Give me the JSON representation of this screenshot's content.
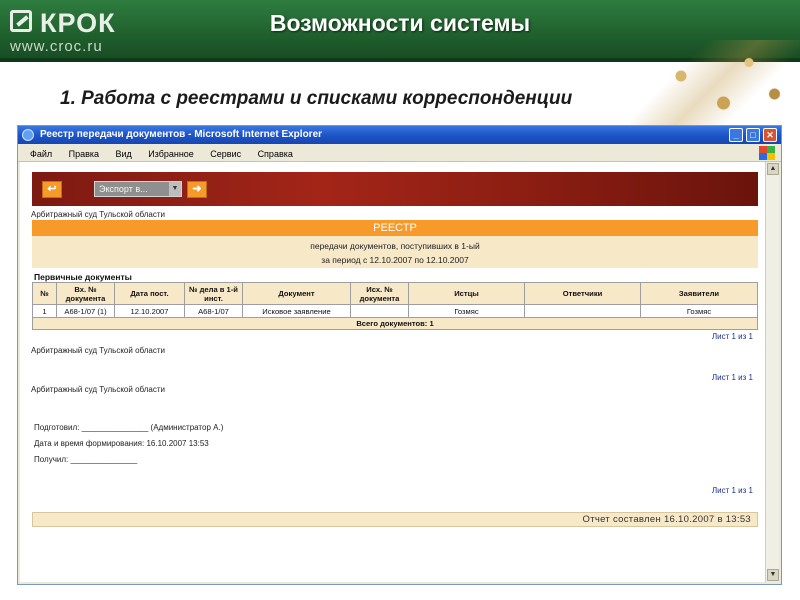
{
  "slide": {
    "logo_text": "КРОК",
    "logo_url": "www.croc.ru",
    "title": "Возможности системы",
    "subtitle": "1. Работа с реестрами и списками корреспонденции"
  },
  "browser": {
    "window_title": "Реестр передачи документов - Microsoft Internet Explorer",
    "menu": [
      "Файл",
      "Правка",
      "Вид",
      "Избранное",
      "Сервис",
      "Справка"
    ]
  },
  "page": {
    "export_select": "Экспорт в...",
    "court_name": "Арбитражный суд Тульской области",
    "registry_title": "РЕЕСТР",
    "registry_line1": "передачи документов, поступивших в 1-ый",
    "registry_line2": "за период с 12.10.2007 по 12.10.2007",
    "primary_docs_label": "Первичные документы",
    "table": {
      "headers": [
        "№",
        "Вх. № документа",
        "Дата пост.",
        "№ дела в 1-й инст.",
        "Документ",
        "Исх. № документа",
        "Истцы",
        "Ответчики",
        "Заявители"
      ],
      "rows": [
        [
          "1",
          "А68-1/07 (1)",
          "12.10.2007",
          "А68-1/07",
          "Исковое заявление",
          "",
          "Гозмяс",
          "",
          "Гозмяс"
        ]
      ],
      "total": "Всего документов: 1"
    },
    "sheet_label": "Лист 1 из 1",
    "prepared_by": "Подготовил: _______________ (Администратор А.)",
    "generated_at": "Дата и время формирования: 16.10.2007 13:53",
    "received_by": "Получил: _______________",
    "report_footer": "Отчет составлен 16.10.2007 в 13:53"
  }
}
